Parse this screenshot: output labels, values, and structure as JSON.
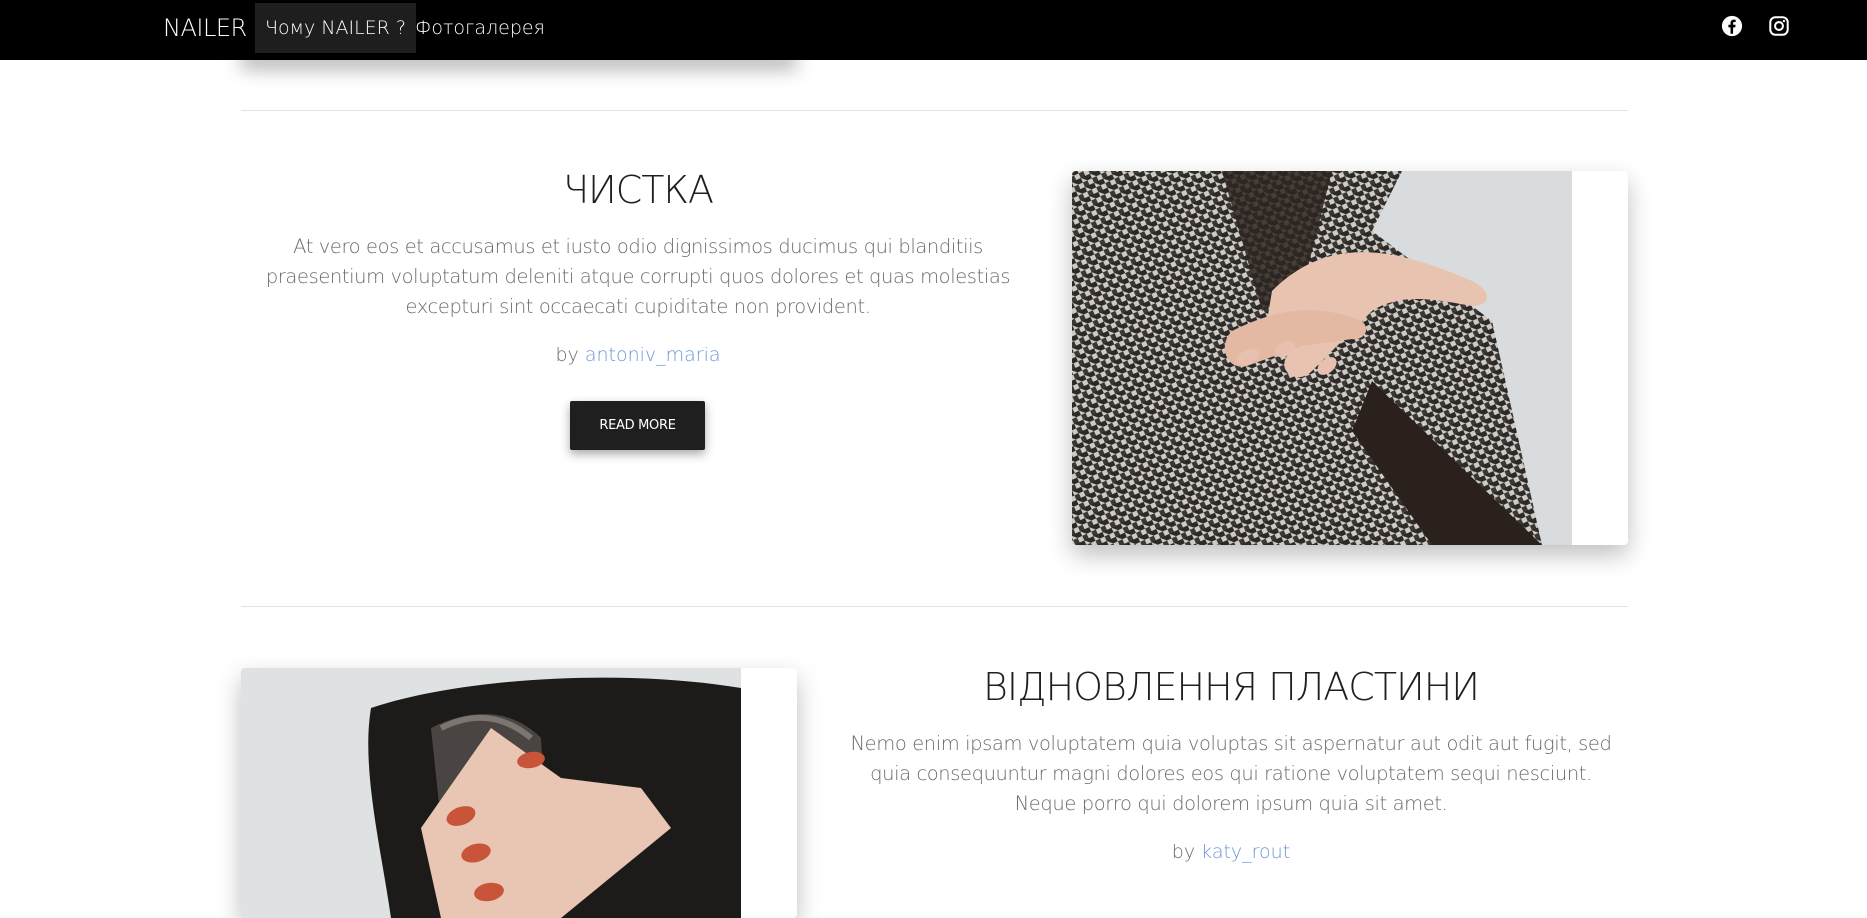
{
  "nav": {
    "brand": "NAILER",
    "items": [
      {
        "label": "Чому NAILER ?",
        "active": true
      },
      {
        "label": "Фотогалерея",
        "active": false
      }
    ],
    "social": [
      "facebook-icon",
      "instagram-icon"
    ]
  },
  "sections": [
    {
      "title": "ЧИСТКА",
      "text": "At vero eos et accusamus et iusto odio dignissimos ducimus qui blanditiis praesentium voluptatum deleniti atque corrupti quos dolores et quas molestias excepturi sint occaecati cupiditate non provident.",
      "by": "by",
      "author": "antoniv_maria",
      "button": "READ MORE"
    },
    {
      "title": "ВІДНОВЛЕННЯ ПЛАСТИНИ",
      "text": "Nemo enim ipsam voluptatem quia voluptas sit aspernatur aut odit aut fugit, sed quia consequuntur magni dolores eos qui ratione voluptatem sequi nesciunt. Neque porro qui dolorem ipsum quia sit amet.",
      "by": "by",
      "author": "katy_rout"
    }
  ],
  "colors": {
    "navbar": "#000000",
    "nav_active": "#1e1e1e",
    "button": "#1f1f1f",
    "link": "#6d95d8",
    "body_text": "#6a6a6a",
    "title": "#1f1f1f"
  }
}
